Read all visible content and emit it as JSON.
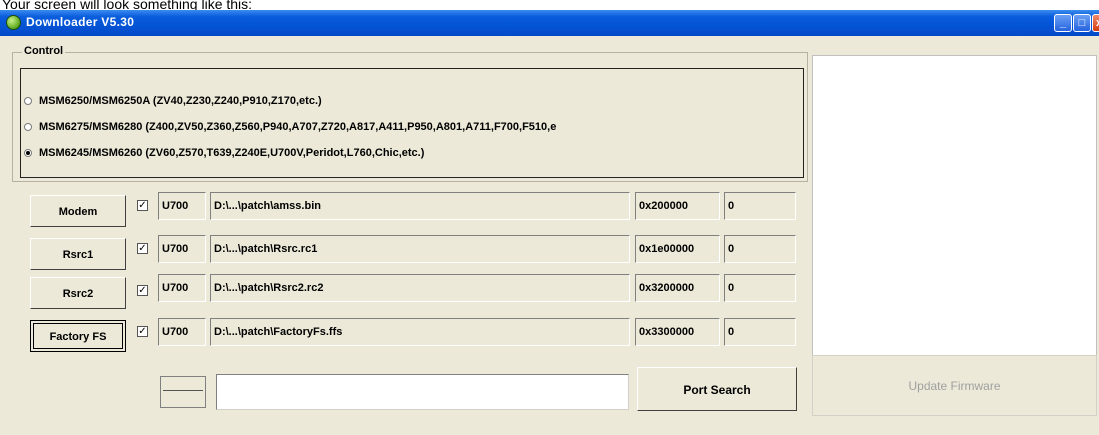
{
  "caption": "Your screen will look something like this:",
  "window": {
    "title": "Downloader V5.30"
  },
  "control": {
    "label": "Control",
    "options": [
      {
        "text": "MSM6250/MSM6250A (ZV40,Z230,Z240,P910,Z170,etc.)",
        "selected": false
      },
      {
        "text": "MSM6275/MSM6280 (Z400,ZV50,Z360,Z560,P940,A707,Z720,A817,A411,P950,A801,A711,F700,F510,e",
        "selected": false
      },
      {
        "text": "MSM6245/MSM6260 (ZV60,Z570,T639,Z240E,U700V,Peridot,L760,Chic,etc.)",
        "selected": true
      }
    ]
  },
  "rows": [
    {
      "button": "Modem",
      "checked": true,
      "model": "U700",
      "path": "D:\\...\\patch\\amss.bin",
      "address": "0x200000",
      "value": "0"
    },
    {
      "button": "Rsrc1",
      "checked": true,
      "model": "U700",
      "path": "D:\\...\\patch\\Rsrc.rc1",
      "address": "0x1e00000",
      "value": "0"
    },
    {
      "button": "Rsrc2",
      "checked": true,
      "model": "U700",
      "path": "D:\\...\\patch\\Rsrc2.rc2",
      "address": "0x3200000",
      "value": "0"
    },
    {
      "button": "Factory FS",
      "checked": true,
      "model": "U700",
      "path": "D:\\...\\patch\\FactoryFs.ffs",
      "address": "0x3300000",
      "value": "0"
    }
  ],
  "port": {
    "search_label": "Port Search",
    "input_value": ""
  },
  "update": {
    "label": "Update Firmware"
  },
  "icons": {
    "app": "app-icon",
    "checkbox": "checkbox-icon"
  }
}
